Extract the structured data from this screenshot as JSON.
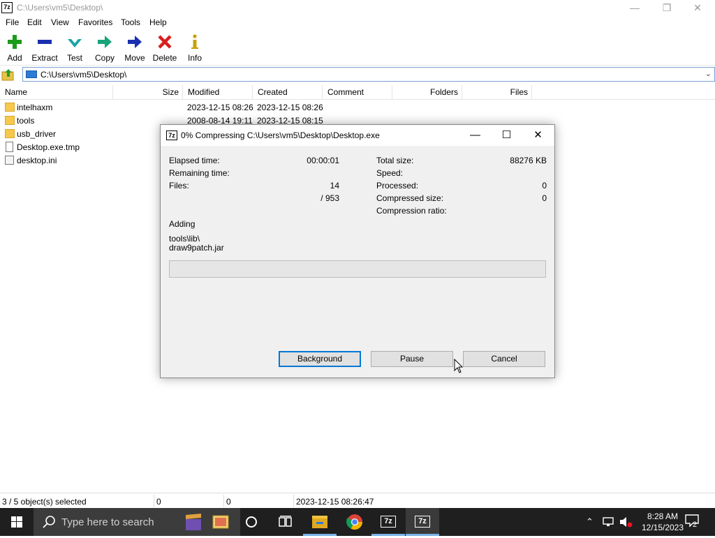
{
  "window": {
    "title": "C:\\Users\\vm5\\Desktop\\",
    "icon_text": "7z"
  },
  "menu": [
    "File",
    "Edit",
    "View",
    "Favorites",
    "Tools",
    "Help"
  ],
  "toolbar": [
    {
      "label": "Add",
      "icon": "plus-icon",
      "color": "#1a9c1a"
    },
    {
      "label": "Extract",
      "icon": "minus-icon",
      "color": "#1a2fb0"
    },
    {
      "label": "Test",
      "icon": "check-icon",
      "color": "#1aa3a3"
    },
    {
      "label": "Copy",
      "icon": "copy-arrow-icon",
      "color": "#1aa37a"
    },
    {
      "label": "Move",
      "icon": "move-arrow-icon",
      "color": "#1a2fb0"
    },
    {
      "label": "Delete",
      "icon": "x-icon",
      "color": "#d81e1e"
    },
    {
      "label": "Info",
      "icon": "info-icon",
      "color": "#c8a000"
    }
  ],
  "address": {
    "path": "C:\\Users\\vm5\\Desktop\\"
  },
  "columns": [
    "Name",
    "Size",
    "Modified",
    "Created",
    "Comment",
    "Folders",
    "Files"
  ],
  "files": [
    {
      "name": "intelhaxm",
      "type": "folder",
      "modified": "2023-12-15 08:26",
      "created": "2023-12-15 08:26"
    },
    {
      "name": "tools",
      "type": "folder",
      "modified": "2008-08-14 19:11",
      "created": "2023-12-15 08:15"
    },
    {
      "name": "usb_driver",
      "type": "folder",
      "modified": "",
      "created": ""
    },
    {
      "name": "Desktop.exe.tmp",
      "type": "file",
      "modified": "",
      "created": ""
    },
    {
      "name": "desktop.ini",
      "type": "ini",
      "modified": "",
      "created": ""
    }
  ],
  "status": {
    "selected": "3 / 5 object(s) selected",
    "size": "0",
    "packed": "0",
    "date": "2023-12-15 08:26:47"
  },
  "dialog": {
    "title": "0% Compressing C:\\Users\\vm5\\Desktop\\Desktop.exe",
    "icon_text": "7z",
    "elapsed_label": "Elapsed time:",
    "elapsed_value": "00:00:01",
    "remaining_label": "Remaining time:",
    "files_label": "Files:",
    "files_value": "14",
    "files_total": "/ 953",
    "total_size_label": "Total size:",
    "total_size_value": "88276 KB",
    "speed_label": "Speed:",
    "processed_label": "Processed:",
    "processed_value": "0",
    "compressed_label": "Compressed size:",
    "compressed_value": "0",
    "ratio_label": "Compression ratio:",
    "status": "Adding",
    "current_dir": "tools\\lib\\",
    "current_file": "draw9patch.jar",
    "progress_percent": 0,
    "buttons": {
      "background": "Background",
      "pause": "Pause",
      "cancel": "Cancel"
    }
  },
  "taskbar": {
    "search_placeholder": "Type here to search",
    "time": "8:28 AM",
    "date": "12/15/2023",
    "notification_count": "2",
    "icon_text_1": "7z",
    "icon_text_2": "7z"
  }
}
